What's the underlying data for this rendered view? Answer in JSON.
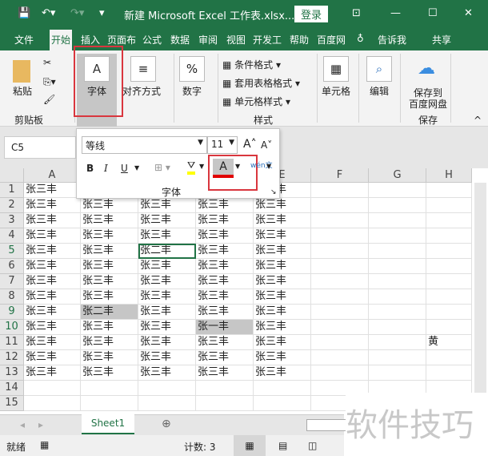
{
  "titlebar": {
    "title": "新建 Microsoft Excel 工作表.xlsx...",
    "login": "登录"
  },
  "tabs": [
    "文件",
    "开始",
    "插入",
    "页面布",
    "公式",
    "数据",
    "审阅",
    "视图",
    "开发工",
    "帮助",
    "百度网"
  ],
  "tell_me": "告诉我",
  "share": "共享",
  "ribbon": {
    "paste": "粘贴",
    "clipboard": "剪贴板",
    "font": "字体",
    "align": "对齐方式",
    "number": "数字",
    "cond_format": "条件格式",
    "table_format": "套用表格格式",
    "cell_style": "单元格样式",
    "styles": "样式",
    "cells": "单元格",
    "edit": "编辑",
    "save_baidu": "保存到\n百度网盘",
    "save_baidu1": "保存到",
    "save_baidu2": "百度网盘",
    "save": "保存"
  },
  "namebox": "C5",
  "font_popup": {
    "font_name": "等线",
    "font_size": "11",
    "bold": "B",
    "italic": "I",
    "underline": "U",
    "group_label": "字体",
    "font_color": "#e00000",
    "highlight_color": "#ffff00"
  },
  "columns": [
    "A",
    "B",
    "C",
    "D",
    "E",
    "F",
    "G",
    "H"
  ],
  "rows": [
    [
      "张三丰",
      "张三丰",
      "张三丰",
      "张三丰",
      "张三丰",
      "",
      "",
      ""
    ],
    [
      "张三丰",
      "张三丰",
      "张三丰",
      "张三丰",
      "张三丰",
      "",
      "",
      ""
    ],
    [
      "张三丰",
      "张三丰",
      "张三丰",
      "张三丰",
      "张三丰",
      "",
      "",
      ""
    ],
    [
      "张三丰",
      "张三丰",
      "张三丰",
      "张三丰",
      "张三丰",
      "",
      "",
      ""
    ],
    [
      "张三丰",
      "张三丰",
      "张二丰",
      "张三丰",
      "张三丰",
      "",
      "",
      ""
    ],
    [
      "张三丰",
      "张三丰",
      "张三丰",
      "张三丰",
      "张三丰",
      "",
      "",
      ""
    ],
    [
      "张三丰",
      "张三丰",
      "张三丰",
      "张三丰",
      "张三丰",
      "",
      "",
      ""
    ],
    [
      "张三丰",
      "张三丰",
      "张三丰",
      "张三丰",
      "张三丰",
      "",
      "",
      ""
    ],
    [
      "张三丰",
      "张二丰",
      "张三丰",
      "张三丰",
      "张三丰",
      "",
      "",
      ""
    ],
    [
      "张三丰",
      "张三丰",
      "张三丰",
      "张一丰",
      "张三丰",
      "",
      "",
      ""
    ],
    [
      "张三丰",
      "张三丰",
      "张三丰",
      "张三丰",
      "张三丰",
      "",
      "",
      "黄"
    ],
    [
      "张三丰",
      "张三丰",
      "张三丰",
      "张三丰",
      "张三丰",
      "",
      "",
      ""
    ],
    [
      "张三丰",
      "张三丰",
      "张三丰",
      "张三丰",
      "张三丰",
      "",
      "",
      ""
    ],
    [
      "",
      "",
      "",
      "",
      "",
      "",
      "",
      ""
    ],
    [
      "",
      "",
      "",
      "",
      "",
      "",
      "",
      ""
    ]
  ],
  "sheet_tab": "Sheet1",
  "status": {
    "ready": "就绪",
    "count": "计数: 3"
  },
  "watermark": "软件技巧"
}
